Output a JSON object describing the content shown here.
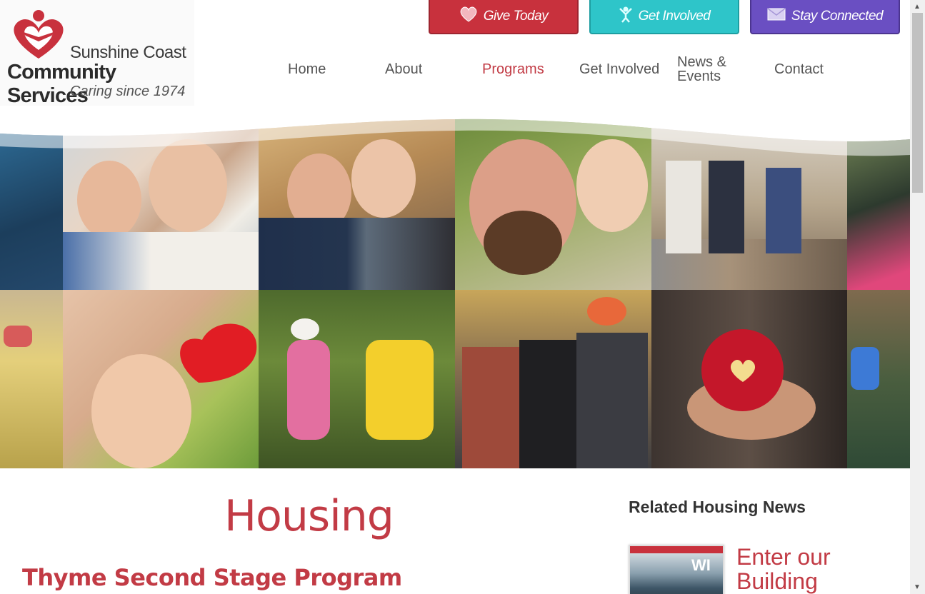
{
  "logo": {
    "line1": "Sunshine Coast",
    "line2": "Community Services",
    "tagline": "Caring since 1974"
  },
  "cta": {
    "give": {
      "label": "Give Today",
      "icon": "heart-icon",
      "color": "#c8313d"
    },
    "involved": {
      "label": "Get Involved",
      "icon": "person-icon",
      "color": "#2ec5c9"
    },
    "connected": {
      "label": "Stay Connected",
      "icon": "envelope-icon",
      "color": "#6a4fc2"
    }
  },
  "nav": {
    "items": [
      {
        "label": "Home",
        "active": false
      },
      {
        "label": "About",
        "active": false
      },
      {
        "label": "Programs",
        "active": true
      },
      {
        "label": "Get Involved",
        "active": false
      },
      {
        "label": "News & Events",
        "active": false
      },
      {
        "label": "Contact",
        "active": false
      }
    ],
    "news_line1": "News &",
    "news_line2": "Events"
  },
  "page": {
    "title": "Housing",
    "section_heading": "Thyme Second Stage Program"
  },
  "sidebar": {
    "related_heading": "Related Housing News",
    "news_items": [
      {
        "title": "Enter our Building",
        "thumb_caption": "WI"
      }
    ]
  },
  "colors": {
    "accent": "#c23b45",
    "text": "#555555"
  }
}
